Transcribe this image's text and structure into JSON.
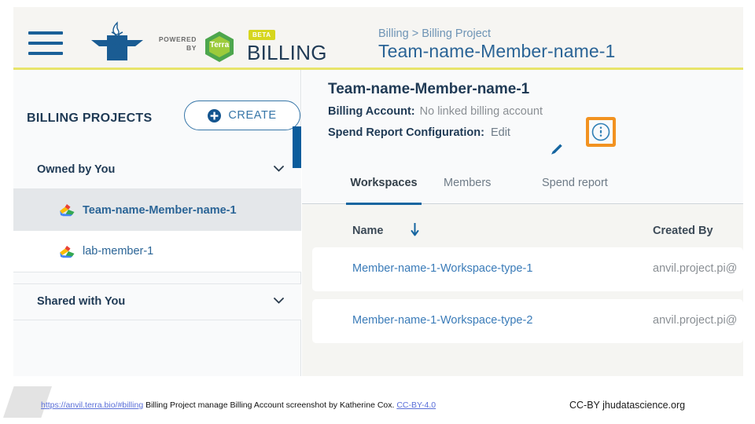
{
  "header": {
    "hamburger_icon": "hamburger-menu-icon",
    "logo_icon": "anvil-logo-icon",
    "powered_line1": "POWERED",
    "powered_line2": "BY",
    "terra_label": "Terra",
    "beta_badge": "BETA",
    "product_word": "BILLING",
    "breadcrumb": "Billing > Billing Project",
    "page_title": "Team-name-Member-name-1"
  },
  "sidebar": {
    "title": "BILLING PROJECTS",
    "create_button": "CREATE",
    "create_icon": "plus-circle-icon",
    "groups": [
      {
        "label": "Owned by You",
        "chevron_icon": "chevron-down-icon"
      },
      {
        "label": "Shared with You",
        "chevron_icon": "chevron-down-icon"
      }
    ],
    "projects": [
      {
        "label": "Team-name-Member-name-1",
        "icon": "google-cloud-icon",
        "selected": true
      },
      {
        "label": "lab-member-1",
        "icon": "google-cloud-icon",
        "selected": false
      }
    ]
  },
  "main": {
    "title": "Team-name-Member-name-1",
    "billing_account_label": "Billing Account:",
    "billing_account_value": "No linked billing account",
    "info_icon": "info-circle-icon",
    "spend_report_label": "Spend Report Configuration:",
    "spend_report_value": "Edit",
    "edit_icon": "pencil-icon",
    "tabs": [
      {
        "label": "Workspaces",
        "active": true
      },
      {
        "label": "Members",
        "active": false
      },
      {
        "label": "Spend report",
        "active": false
      }
    ],
    "table": {
      "columns": [
        "Name",
        "Created By"
      ],
      "sort_icon": "sort-descending-arrow-icon",
      "rows": [
        {
          "name": "Member-name-1-Workspace-type-1",
          "created_by": "anvil.project.pi@"
        },
        {
          "name": "Member-name-1-Workspace-type-2",
          "created_by": "anvil.project.pi@"
        }
      ]
    }
  },
  "caption": {
    "source_url": "https://anvil.terra.bio/#billing",
    "text": " Billing Project manage Billing Account screenshot by Katherine Cox. ",
    "license": "CC-BY-4.0",
    "right": "CC-BY  jhudatascience.org"
  },
  "colors": {
    "accent_blue": "#1565a0",
    "link_blue": "#3a7bb8",
    "highlight_orange": "#f29220",
    "beta_yellow": "#d6d61e",
    "rule_yellow": "#e8e46a"
  }
}
